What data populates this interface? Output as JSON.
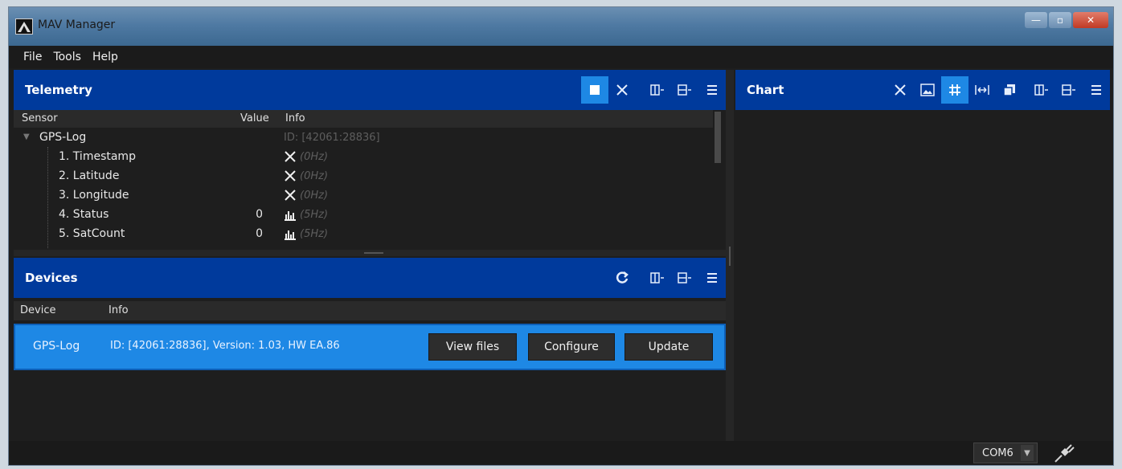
{
  "window": {
    "title": "MAV Manager",
    "controls": [
      "—",
      "▫",
      "✕"
    ]
  },
  "menu": [
    "File",
    "Tools",
    "Help"
  ],
  "telemetry": {
    "title": "Telemetry",
    "columns": {
      "sensor": "Sensor",
      "value": "Value",
      "info": "Info"
    },
    "group": {
      "name": "GPS-Log",
      "info": "ID: [42061:28836]"
    },
    "rows": [
      {
        "name": "1. Timestamp",
        "value": "",
        "status": "x",
        "info": "(0Hz)"
      },
      {
        "name": "2. Latitude",
        "value": "",
        "status": "x",
        "info": "(0Hz)"
      },
      {
        "name": "3. Longitude",
        "value": "",
        "status": "x",
        "info": "(0Hz)"
      },
      {
        "name": "4. Status",
        "value": "0",
        "status": "chart",
        "info": "(5Hz)"
      },
      {
        "name": "5. SatCount",
        "value": "0",
        "status": "chart",
        "info": "(5Hz)"
      }
    ]
  },
  "devices": {
    "title": "Devices",
    "columns": {
      "device": "Device",
      "info": "Info"
    },
    "row": {
      "name": "GPS-Log",
      "info": "ID: [42061:28836], Version: 1.03, HW EA.86",
      "buttons": {
        "view_files": "View files",
        "configure": "Configure",
        "update": "Update"
      }
    }
  },
  "chart": {
    "title": "Chart"
  },
  "status": {
    "port": "COM6"
  },
  "colors": {
    "header": "#003a9c",
    "accent": "#1e88e5",
    "background": "#1e1e1e"
  }
}
